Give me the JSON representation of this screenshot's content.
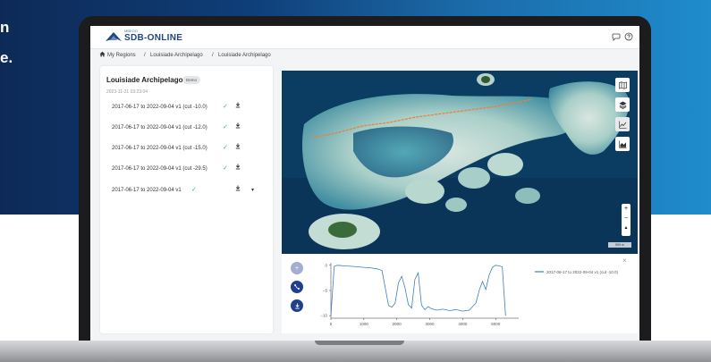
{
  "tagline": {
    "line1": "n",
    "line2": "e."
  },
  "app": {
    "logo_small": "MBEOO",
    "logo_name": "SDB-ONLINE",
    "header_icons": [
      "chat-bubble-icon",
      "help-circle-icon"
    ]
  },
  "breadcrumb": {
    "items": [
      "My Regions",
      "Louisiade Archipelago",
      "Louisiade Archipelago"
    ],
    "separator": "/"
  },
  "region": {
    "title": "Louisiade Archipelago",
    "badge": "Demo",
    "date": "2023-11-21 03:23:04",
    "runs": [
      {
        "label": "2017-06-17 to 2022-09-04 v1 (cut -10.0)",
        "status": "done"
      },
      {
        "label": "2017-06-17 to 2022-09-04 v1 (cut -12.0)",
        "status": "done"
      },
      {
        "label": "2017-06-17 to 2022-09-04 v1 (cut -15.0)",
        "status": "done"
      },
      {
        "label": "2017-06-17 to 2022-09-04 v1 (cut -29.5)",
        "status": "done"
      },
      {
        "label": "2017-06-17 to 2022-09-04 v1",
        "status": "done",
        "more": "▾"
      }
    ]
  },
  "map": {
    "tools": [
      "map-icon",
      "layers-icon",
      "line-chart-icon",
      "bar-chart-icon"
    ],
    "zoom": {
      "in": "+",
      "out": "−",
      "north": "▲"
    },
    "scale": "500 m"
  },
  "profile": {
    "fab_icons": [
      "plus-icon",
      "draw-line-icon",
      "download-icon"
    ],
    "close": "×",
    "legend": "2017-06-17 to 2022-09-04 v1 (cut -10.0)"
  },
  "chart_data": {
    "type": "line",
    "title": "",
    "xlabel": "",
    "ylabel": "",
    "xlim": [
      0,
      5700
    ],
    "ylim": [
      -10.5,
      0.5
    ],
    "xticks": [
      0,
      1000,
      2000,
      3000,
      4000,
      5000
    ],
    "yticks": [
      0,
      -5,
      -10
    ],
    "ytick_labels": [
      "0",
      "−5",
      "−10"
    ],
    "grid": false,
    "legend_position": "right",
    "series": [
      {
        "name": "2017-06-17 to 2022-09-04 v1 (cut -10.0)",
        "color": "#3b7fc4",
        "x": [
          0,
          100,
          200,
          400,
          600,
          800,
          1000,
          1200,
          1400,
          1550,
          1650,
          1750,
          1850,
          1950,
          2050,
          2150,
          2250,
          2350,
          2450,
          2550,
          2650,
          2750,
          2850,
          2950,
          3050,
          3200,
          3400,
          3600,
          3800,
          4000,
          4200,
          4400,
          4500,
          4600,
          4700,
          4800,
          4900,
          5000,
          5100,
          5200,
          5300
        ],
        "y": [
          -10,
          -0.2,
          0,
          -0.1,
          -0.2,
          -0.3,
          -0.4,
          -0.5,
          -0.7,
          -1.0,
          -4.5,
          -8.0,
          -8.3,
          -7.5,
          -3.5,
          -2.2,
          -4.5,
          -7.8,
          -8.5,
          -2.8,
          -1.5,
          -7.9,
          -8.8,
          -8.2,
          -8.6,
          -8.9,
          -8.7,
          -9.0,
          -8.8,
          -9.1,
          -8.9,
          -7.5,
          -5.0,
          -3.2,
          -4.8,
          -2.0,
          -0.4,
          0,
          -0.1,
          -0.3,
          -10
        ]
      }
    ]
  },
  "colors": {
    "brand": "#23467e",
    "accent": "#1f3f8f",
    "check": "#4caf50",
    "route": "#e8823a"
  }
}
